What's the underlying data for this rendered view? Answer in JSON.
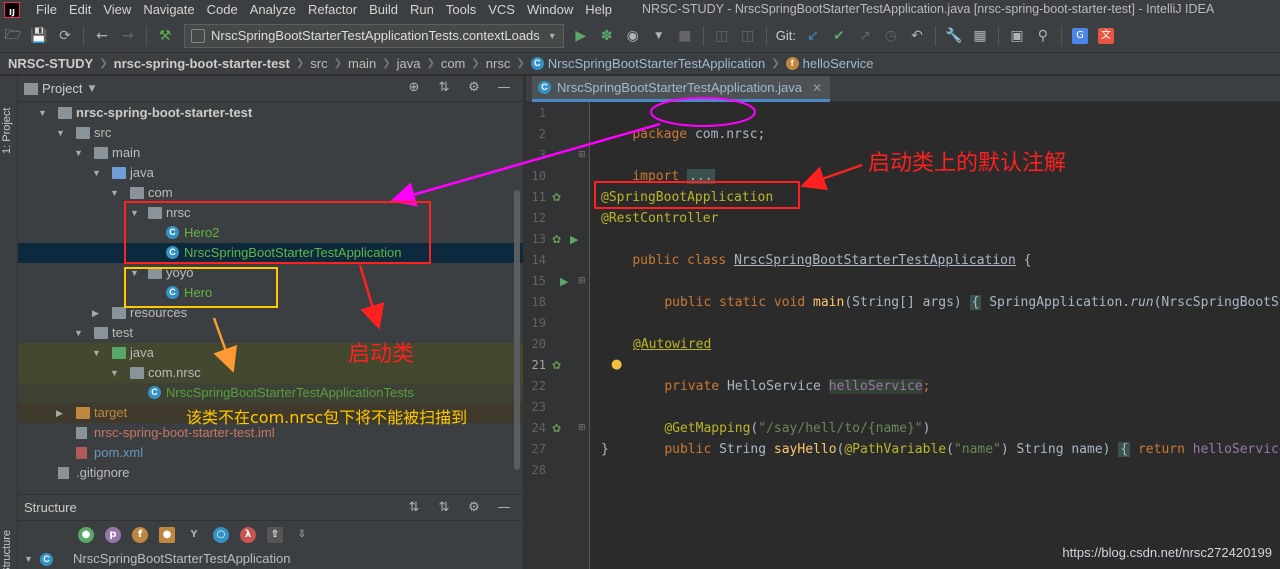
{
  "menubar": {
    "items": [
      "File",
      "Edit",
      "View",
      "Navigate",
      "Code",
      "Analyze",
      "Refactor",
      "Build",
      "Run",
      "Tools",
      "VCS",
      "Window",
      "Help"
    ],
    "title": "NRSC-STUDY - NrscSpringBootStarterTestApplication.java [nrsc-spring-boot-starter-test] - IntelliJ IDEA"
  },
  "toolbar": {
    "run_config": "NrscSpringBootStarterTestApplicationTests.contextLoads",
    "git_label": "Git:"
  },
  "breadcrumb": {
    "items": [
      "NRSC-STUDY",
      "nrsc-spring-boot-starter-test",
      "src",
      "main",
      "java",
      "com",
      "nrsc",
      "NrscSpringBootStarterTestApplication",
      "helloService"
    ]
  },
  "sidebar": {
    "project_tab": "1: Project",
    "structure_tab": "Structure"
  },
  "project_panel": {
    "title": "Project",
    "tree": [
      {
        "label": "nrsc-spring-boot-starter-test"
      },
      {
        "label": "src"
      },
      {
        "label": "main"
      },
      {
        "label": "java"
      },
      {
        "label": "com"
      },
      {
        "label": "nrsc"
      },
      {
        "label": "Hero2"
      },
      {
        "label": "NrscSpringBootStarterTestApplication"
      },
      {
        "label": "yoyo"
      },
      {
        "label": "Hero"
      },
      {
        "label": "resources"
      },
      {
        "label": "test"
      },
      {
        "label": "java"
      },
      {
        "label": "com.nrsc"
      },
      {
        "label": "NrscSpringBootStarterTestApplicationTests"
      },
      {
        "label": "target"
      },
      {
        "label": "nrsc-spring-boot-starter-test.iml"
      },
      {
        "label": "pom.xml"
      },
      {
        "label": ".gitignore"
      }
    ]
  },
  "structure_panel": {
    "title": "Structure",
    "root": "NrscSpringBootStarterTestApplication"
  },
  "editor": {
    "tab_label": "NrscSpringBootStarterTestApplication.java",
    "line_numbers": [
      "1",
      "2",
      "3",
      "10",
      "11",
      "12",
      "13",
      "14",
      "15",
      "18",
      "19",
      "20",
      "21",
      "22",
      "23",
      "24",
      "27",
      "28"
    ],
    "code": {
      "l1_kw": "package ",
      "l1_pkg": "com.nrsc;",
      "l3_kw": "import ",
      "l3_fold": "...",
      "l11": "@SpringBootApplication",
      "l12": "@RestController",
      "l13_kw": "public class ",
      "l13_cls": "NrscSpringBootStarterTestApplication",
      "l13_brace": " {",
      "l15_kw": "public static void ",
      "l15_fn": "main",
      "l15_args": "(String[] args) ",
      "l15_fold": "{",
      "l15_rest1": " SpringApplication.",
      "l15_run": "run",
      "l15_rest2": "(NrscSpringBootStar",
      "l20": "@Autowired",
      "l21_kw": "private ",
      "l21_type": "HelloService ",
      "l21_fld": "helloService",
      "l21_semi": ";",
      "l23_ann": "@GetMapping",
      "l23_open": "(",
      "l23_str": "\"/say/hell/to/{name}\"",
      "l23_close": ")",
      "l24_kw": "public ",
      "l24_type": "String ",
      "l24_fn": "sayHello",
      "l24_open": "(",
      "l24_ann": "@PathVariable",
      "l24_p1": "(",
      "l24_str": "\"name\"",
      "l24_p2": ") String name) ",
      "l24_fold": "{",
      "l24_ret": " return ",
      "l24_fld": "helloService",
      "l24_tail": ".s",
      "l27": "}"
    }
  },
  "annotations": {
    "default_annotation": "启动类上的默认注解",
    "startup_class": "启动类",
    "not_scanned": "该类不在com.nrsc包下将不能被扫描到"
  },
  "watermark": "https://blog.csdn.net/nrsc272420199",
  "colors": {
    "red": "#ff2020",
    "magenta": "#ff00ff",
    "yellow": "#ffc800",
    "orange": "#ff9933"
  }
}
